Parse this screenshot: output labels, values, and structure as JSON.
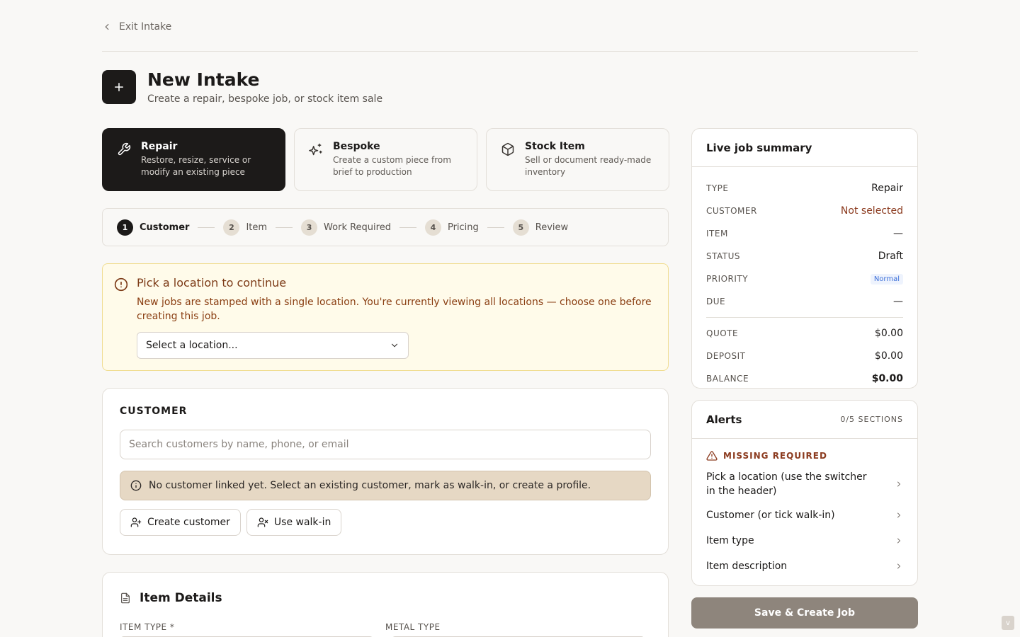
{
  "nav": {
    "exit_label": "Exit Intake"
  },
  "header": {
    "title": "New Intake",
    "subtitle": "Create a repair, bespoke job, or stock item sale"
  },
  "job_types": [
    {
      "title": "Repair",
      "desc": "Restore, resize, service or modify an existing piece",
      "active": true,
      "icon": "wrench-icon"
    },
    {
      "title": "Bespoke",
      "desc": "Create a custom piece from brief to production",
      "active": false,
      "icon": "sparkles-icon"
    },
    {
      "title": "Stock Item",
      "desc": "Sell or document ready-made inventory",
      "active": false,
      "icon": "box-icon"
    }
  ],
  "steps": [
    {
      "num": "1",
      "label": "Customer"
    },
    {
      "num": "2",
      "label": "Item"
    },
    {
      "num": "3",
      "label": "Work Required"
    },
    {
      "num": "4",
      "label": "Pricing"
    },
    {
      "num": "5",
      "label": "Review"
    }
  ],
  "location_alert": {
    "title": "Pick a location to continue",
    "text": "New jobs are stamped with a single location. You're currently viewing all locations — choose one before creating this job.",
    "select_placeholder": "Select a location..."
  },
  "customer": {
    "section_title": "CUSTOMER",
    "search_placeholder": "Search customers by name, phone, or email",
    "info": "No customer linked yet. Select an existing customer, mark as walk-in, or create a profile.",
    "create_label": "Create customer",
    "walkin_label": "Use walk-in"
  },
  "item_details": {
    "title": "Item Details",
    "item_type_label": "ITEM TYPE *",
    "metal_type_label": "METAL TYPE"
  },
  "summary": {
    "title": "Live job summary",
    "rows": [
      {
        "key": "TYPE",
        "value": "Repair"
      },
      {
        "key": "CUSTOMER",
        "value": "Not selected"
      },
      {
        "key": "ITEM",
        "value": "—"
      },
      {
        "key": "STATUS",
        "value": "Draft"
      },
      {
        "key": "PRIORITY",
        "value": "Normal"
      },
      {
        "key": "DUE",
        "value": "—"
      }
    ],
    "money": [
      {
        "key": "QUOTE",
        "value": "$0.00"
      },
      {
        "key": "DEPOSIT",
        "value": "$0.00"
      },
      {
        "key": "BALANCE",
        "value": "$0.00"
      }
    ]
  },
  "alerts": {
    "title": "Alerts",
    "count": "0/5 SECTIONS",
    "missing_heading": "MISSING REQUIRED",
    "items": [
      "Pick a location (use the switcher in the header)",
      "Customer (or tick walk-in)",
      "Item type",
      "Item description"
    ]
  },
  "save_label": "Save & Create Job",
  "corner_badge": "v",
  "colors": {
    "accent_dark": "#1c1a19",
    "warning": "#8b3a1e",
    "alert_bg": "#fffbea",
    "info_bg": "#e6d8c4",
    "save_btn": "#8e857c"
  }
}
